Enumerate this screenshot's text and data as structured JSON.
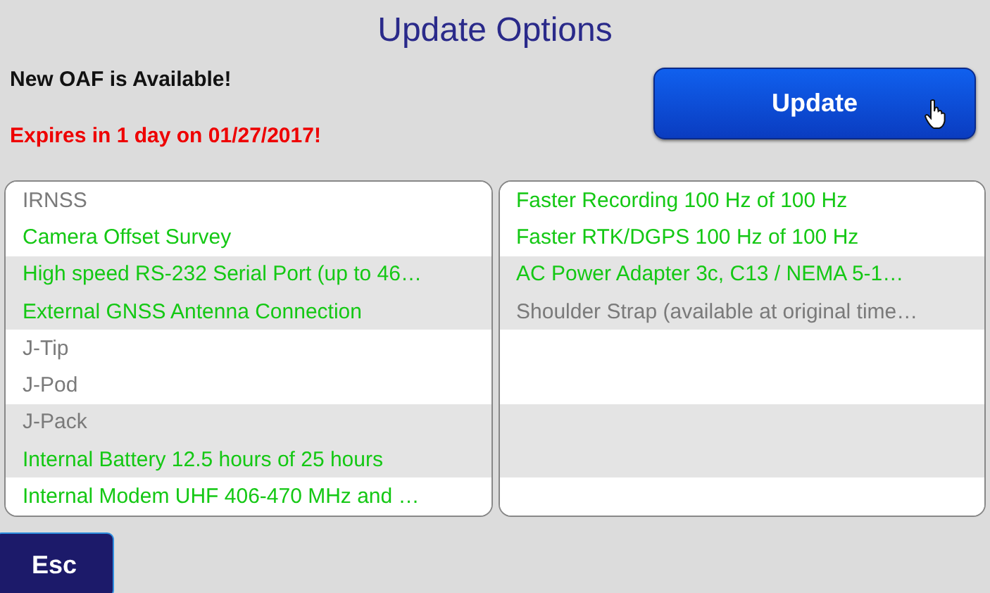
{
  "title": "Update Options",
  "notice": "New OAF is Available!",
  "expiry": "Expires in 1 day on 01/27/2017!",
  "update_button": "Update",
  "left_list": [
    {
      "label": "IRNSS",
      "available": false
    },
    {
      "label": "Camera Offset Survey",
      "available": true
    },
    {
      "label": "High speed RS-232 Serial Port (up to 46…",
      "available": true
    },
    {
      "label": "External GNSS Antenna Connection",
      "available": true
    },
    {
      "label": "J-Tip",
      "available": false
    },
    {
      "label": "J-Pod",
      "available": false
    },
    {
      "label": "J-Pack",
      "available": false
    },
    {
      "label": "Internal Battery 12.5 hours  of 25 hours",
      "available": true
    },
    {
      "label": "Internal Modem UHF 406-470 MHz and …",
      "available": true
    }
  ],
  "right_list": [
    {
      "label": "Faster Recording 100 Hz of 100 Hz",
      "available": true
    },
    {
      "label": "Faster RTK/DGPS 100 Hz of 100 Hz",
      "available": true
    },
    {
      "label": "AC Power Adapter 3c, C13 / NEMA 5-1…",
      "available": true
    },
    {
      "label": "Shoulder Strap (available at original time…",
      "available": false
    }
  ],
  "esc_button": "Esc"
}
